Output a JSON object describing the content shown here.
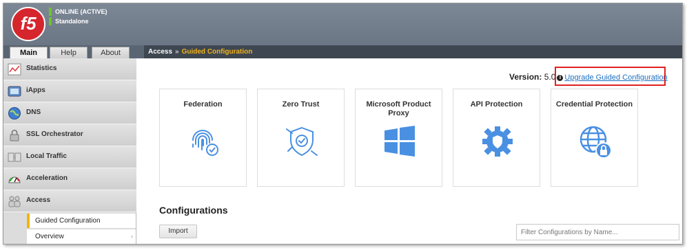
{
  "header": {
    "logo_text": "f5",
    "status": "ONLINE (ACTIVE)",
    "mode": "Standalone"
  },
  "tabs": [
    {
      "label": "Main",
      "active": true
    },
    {
      "label": "Help",
      "active": false
    },
    {
      "label": "About",
      "active": false
    }
  ],
  "breadcrumb": {
    "parent": "Access",
    "separator": "»",
    "current": "Guided Configuration"
  },
  "sidebar": {
    "items": [
      {
        "label": "Statistics",
        "icon": "statistics-icon"
      },
      {
        "label": "iApps",
        "icon": "iapps-icon"
      },
      {
        "label": "DNS",
        "icon": "dns-globe-icon"
      },
      {
        "label": "SSL Orchestrator",
        "icon": "lock-icon"
      },
      {
        "label": "Local Traffic",
        "icon": "local-traffic-icon"
      },
      {
        "label": "Acceleration",
        "icon": "gauge-icon"
      },
      {
        "label": "Access",
        "icon": "access-icon"
      }
    ],
    "subitems": [
      {
        "label": "Guided Configuration",
        "selected": true
      },
      {
        "label": "Overview",
        "selected": false
      }
    ]
  },
  "main": {
    "version_label": "Version:",
    "version_value": "5.0",
    "info_icon": "i",
    "upgrade_link": "Upgrade Guided Configuration",
    "cards": [
      {
        "title": "Federation",
        "icon": "fingerprint-icon"
      },
      {
        "title": "Zero Trust",
        "icon": "shield-check-icon"
      },
      {
        "title": "Microsoft Product Proxy",
        "icon": "windows-icon"
      },
      {
        "title": "API Protection",
        "icon": "gear-shield-icon"
      },
      {
        "title": "Credential Protection",
        "icon": "globe-lock-icon"
      }
    ],
    "configurations_title": "Configurations",
    "import_label": "Import",
    "filter_placeholder": "Filter Configurations by Name..."
  },
  "colors": {
    "accent_blue": "#4a90e2",
    "highlight_red": "#e02020",
    "status_green": "#6ec32c",
    "breadcrumb_yellow": "#f2b21b"
  }
}
